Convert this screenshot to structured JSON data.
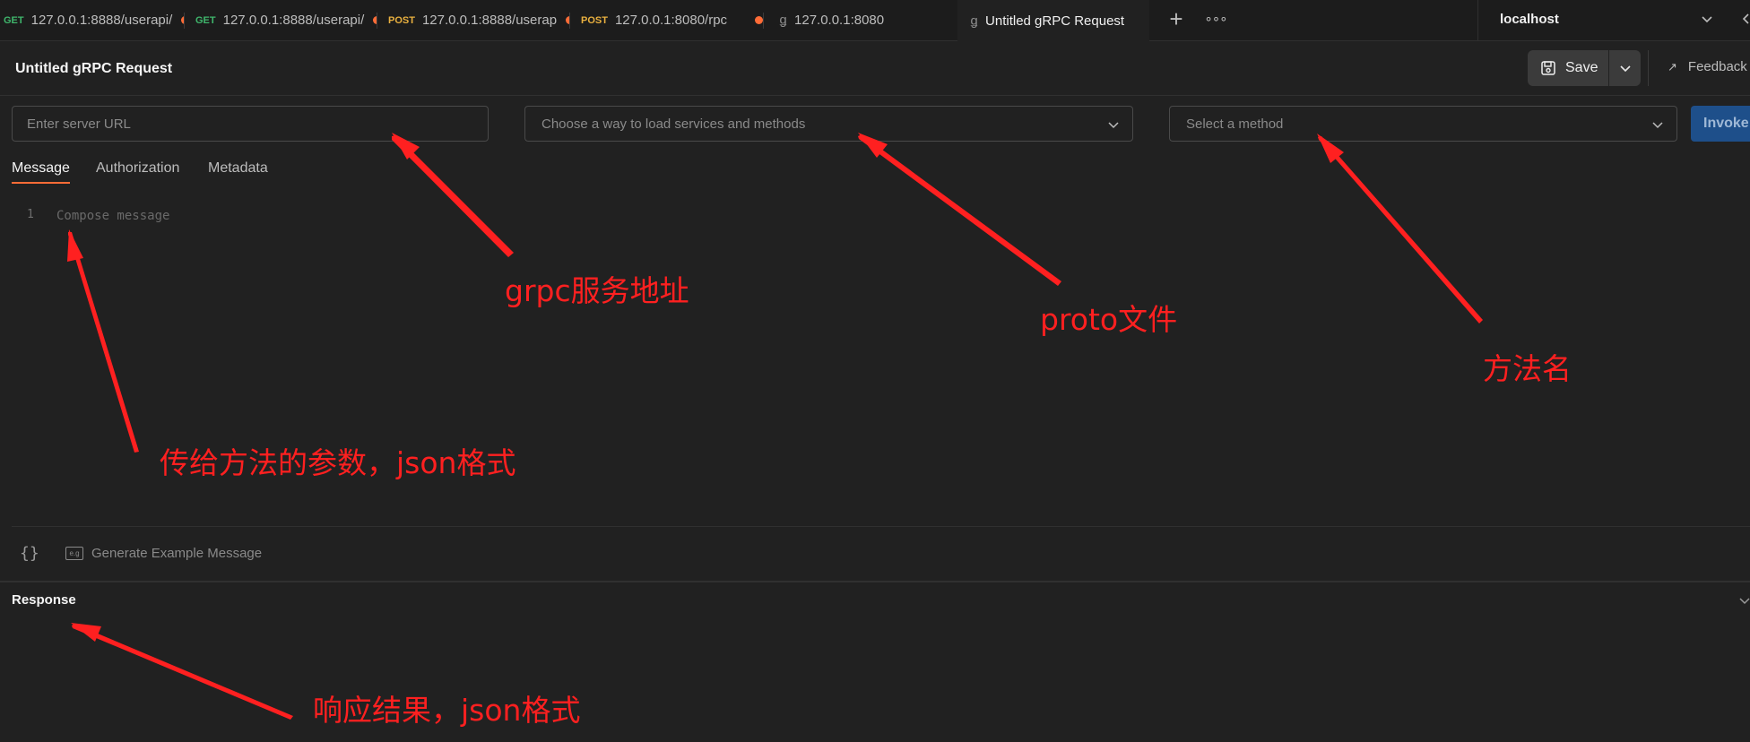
{
  "tabs": [
    {
      "method": "GET",
      "label": "127.0.0.1:8888/userapi/",
      "unsaved": true
    },
    {
      "method": "GET",
      "label": "127.0.0.1:8888/userapi/",
      "unsaved": true
    },
    {
      "method": "POST",
      "label": "127.0.0.1:8888/userap",
      "unsaved": true
    },
    {
      "method": "POST",
      "label": "127.0.0.1:8080/rpc",
      "unsaved": true
    },
    {
      "icon": "grpc-icon",
      "label": "127.0.0.1:8080"
    },
    {
      "icon": "grpc-icon",
      "label": "Untitled gRPC Request",
      "active": true
    }
  ],
  "environment": {
    "selected": "localhost"
  },
  "request": {
    "title": "Untitled gRPC Request",
    "save_label": "Save",
    "feedback_label": "Feedback",
    "server_url_placeholder": "Enter server URL",
    "load_services_placeholder": "Choose a way to load services and methods",
    "method_placeholder": "Select a method",
    "invoke_label": "Invoke"
  },
  "subtabs": [
    "Message",
    "Authorization",
    "Metadata"
  ],
  "editor": {
    "line_number": "1",
    "placeholder": "Compose message"
  },
  "message_toolbar": {
    "braces": "{}",
    "example_badge": "e.g",
    "generate_label": "Generate Example Message"
  },
  "response": {
    "title": "Response"
  },
  "annotations": {
    "server": "grpc服务地址",
    "proto": "proto文件",
    "method": "方法名",
    "params": "传给方法的参数，json格式",
    "response": "响应结果，json格式"
  },
  "colors": {
    "accent": "#ff6c37",
    "annotation": "#ff2020",
    "invoke": "#1e4f8a",
    "get": "#3fb66c",
    "post": "#e9b03f"
  }
}
